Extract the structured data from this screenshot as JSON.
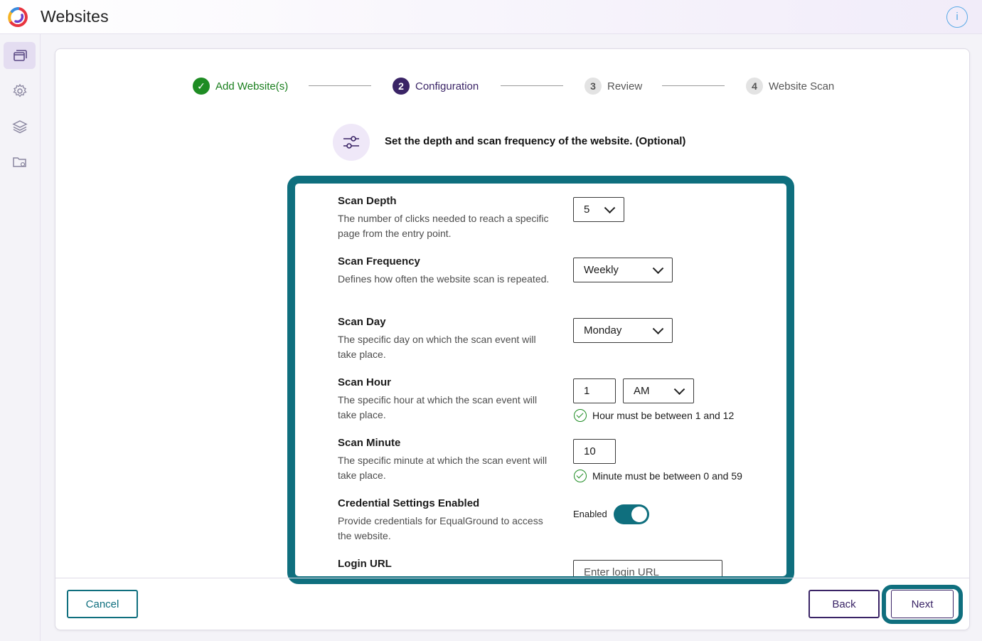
{
  "app": {
    "title": "Websites",
    "info_label": "i"
  },
  "sidebar": {
    "items": [
      {
        "icon": "windows-icon",
        "active": true
      },
      {
        "icon": "gear-icon",
        "active": false
      },
      {
        "icon": "layers-icon",
        "active": false
      },
      {
        "icon": "folder-settings-icon",
        "active": false
      }
    ]
  },
  "stepper": {
    "steps": [
      {
        "number": "✓",
        "label": "Add Website(s)",
        "state": "done"
      },
      {
        "number": "2",
        "label": "Configuration",
        "state": "active"
      },
      {
        "number": "3",
        "label": "Review",
        "state": "pending"
      },
      {
        "number": "4",
        "label": "Website Scan",
        "state": "pending"
      }
    ]
  },
  "intro": {
    "text": "Set the depth and scan frequency of the website. (Optional)",
    "icon": "sliders-icon"
  },
  "form": {
    "scan_depth": {
      "title": "Scan Depth",
      "desc": "The number of clicks needed to reach a specific page from the entry point.",
      "value": "5"
    },
    "scan_frequency": {
      "title": "Scan Frequency",
      "desc": "Defines how often the website scan is repeated.",
      "value": "Weekly"
    },
    "scan_day": {
      "title": "Scan Day",
      "desc": "The specific day on which the scan event will take place.",
      "value": "Monday"
    },
    "scan_hour": {
      "title": "Scan Hour",
      "desc": "The specific hour at which the scan event will take place.",
      "value": "1",
      "ampm": "AM",
      "hint": "Hour must be between 1 and 12"
    },
    "scan_minute": {
      "title": "Scan Minute",
      "desc": "The specific minute at which the scan event will take place.",
      "value": "10",
      "hint": "Minute must be between 0 and 59"
    },
    "credentials": {
      "title": "Credential Settings Enabled",
      "desc": "Provide credentials for EqualGround to access the website.",
      "toggle_label": "Enabled",
      "enabled": true
    },
    "login_url": {
      "title": "Login URL",
      "placeholder": "Enter login URL"
    }
  },
  "footer": {
    "cancel_label": "Cancel",
    "back_label": "Back",
    "next_label": "Next"
  },
  "colors": {
    "accent_teal": "#0f6f7e",
    "primary_purple": "#3a2466",
    "success_green": "#1e8c23"
  }
}
